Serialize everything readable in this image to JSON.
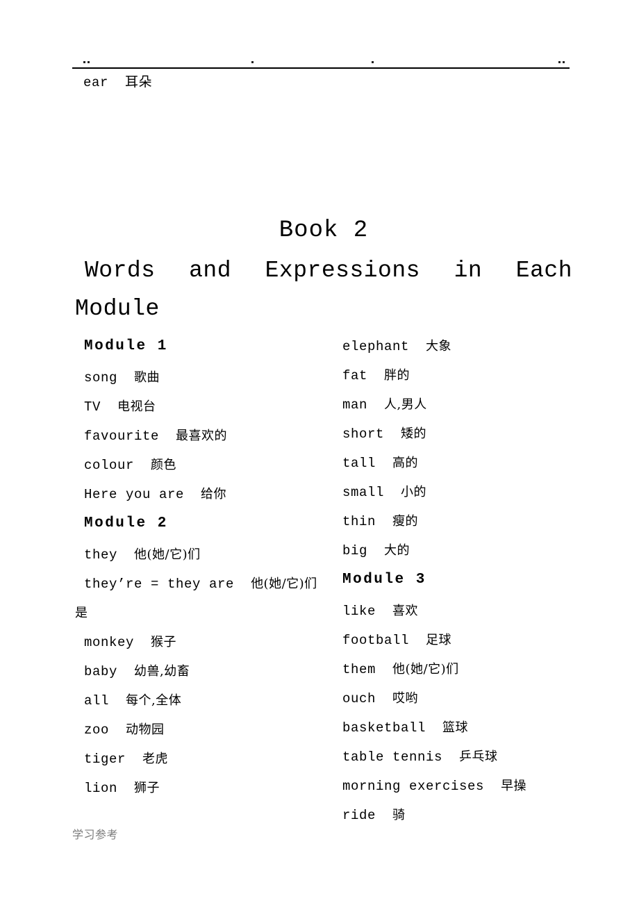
{
  "header": {
    "orphan_entry": "ear  耳朵",
    "rule_visible": true
  },
  "title": {
    "line1": "Book 2",
    "line2": "Words and Expressions in Each",
    "line3": "Module"
  },
  "columns": {
    "left": {
      "sections": [
        {
          "heading": "Module 1",
          "entries": [
            {
              "en": "song",
              "cn": "歌曲"
            },
            {
              "en": "TV",
              "cn": "电视台"
            },
            {
              "en": "favourite",
              "cn": "最喜欢的"
            },
            {
              "en": "colour",
              "cn": "颜色"
            },
            {
              "en": "Here you are",
              "cn": "给你"
            }
          ]
        },
        {
          "heading": "Module 2",
          "entries": [
            {
              "en": "they",
              "cn": "他(她/它)们"
            },
            {
              "en": "they’re = they are",
              "cn": "他(她/它)们",
              "cn_wrap": "是"
            },
            {
              "en": "monkey",
              "cn": "猴子"
            },
            {
              "en": "baby",
              "cn": "幼兽,幼畜"
            },
            {
              "en": "all",
              "cn": "每个,全体"
            },
            {
              "en": "zoo",
              "cn": "动物园"
            },
            {
              "en": "tiger",
              "cn": "老虎"
            },
            {
              "en": "lion",
              "cn": "狮子"
            }
          ]
        }
      ]
    },
    "right": {
      "sections": [
        {
          "heading": null,
          "entries": [
            {
              "en": "elephant",
              "cn": "大象"
            },
            {
              "en": "fat",
              "cn": "胖的"
            },
            {
              "en": "man",
              "cn": "人,男人"
            },
            {
              "en": "short",
              "cn": "矮的"
            },
            {
              "en": "tall",
              "cn": "高的"
            },
            {
              "en": "small",
              "cn": "小的"
            },
            {
              "en": "thin",
              "cn": "瘦的"
            },
            {
              "en": "big",
              "cn": "大的"
            }
          ]
        },
        {
          "heading": "Module 3",
          "entries": [
            {
              "en": "like",
              "cn": "喜欢"
            },
            {
              "en": "football",
              "cn": "足球"
            },
            {
              "en": "them",
              "cn": "他(她/它)们"
            },
            {
              "en": "ouch",
              "cn": "哎哟"
            },
            {
              "en": "basketball",
              "cn": "篮球"
            },
            {
              "en": "table tennis",
              "cn": "乒乓球"
            },
            {
              "en": "morning exercises",
              "cn": "早操"
            },
            {
              "en": "ride",
              "cn": "骑"
            }
          ]
        }
      ]
    }
  },
  "footer": {
    "watermark": "学习参考",
    "color": "#7b7b7b"
  }
}
